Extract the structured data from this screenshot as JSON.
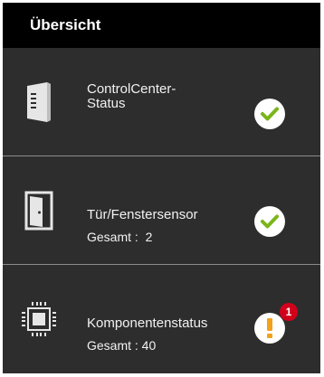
{
  "header": {
    "title": "Übersicht"
  },
  "rows": [
    {
      "title_line1": "ControlCenter-",
      "title_line2": "Status",
      "icon": "control-center-icon",
      "status": "ok",
      "status_icon": "checkmark-icon"
    },
    {
      "title": "Tür/Fenstersensor",
      "subtitle": "Gesamt :  2",
      "icon": "door-icon",
      "status": "ok",
      "status_icon": "checkmark-icon"
    },
    {
      "title": "Komponentenstatus",
      "subtitle": "Gesamt : 40",
      "icon": "chip-icon",
      "status": "warning",
      "status_icon": "exclamation-icon",
      "badge_count": "1"
    }
  ],
  "colors": {
    "background": "#2d2d2d",
    "header": "#000000",
    "ok_green": "#7bb51b",
    "warning_orange": "#f2a11a",
    "badge_red": "#d2001a",
    "divider": "#8a8a8a"
  }
}
